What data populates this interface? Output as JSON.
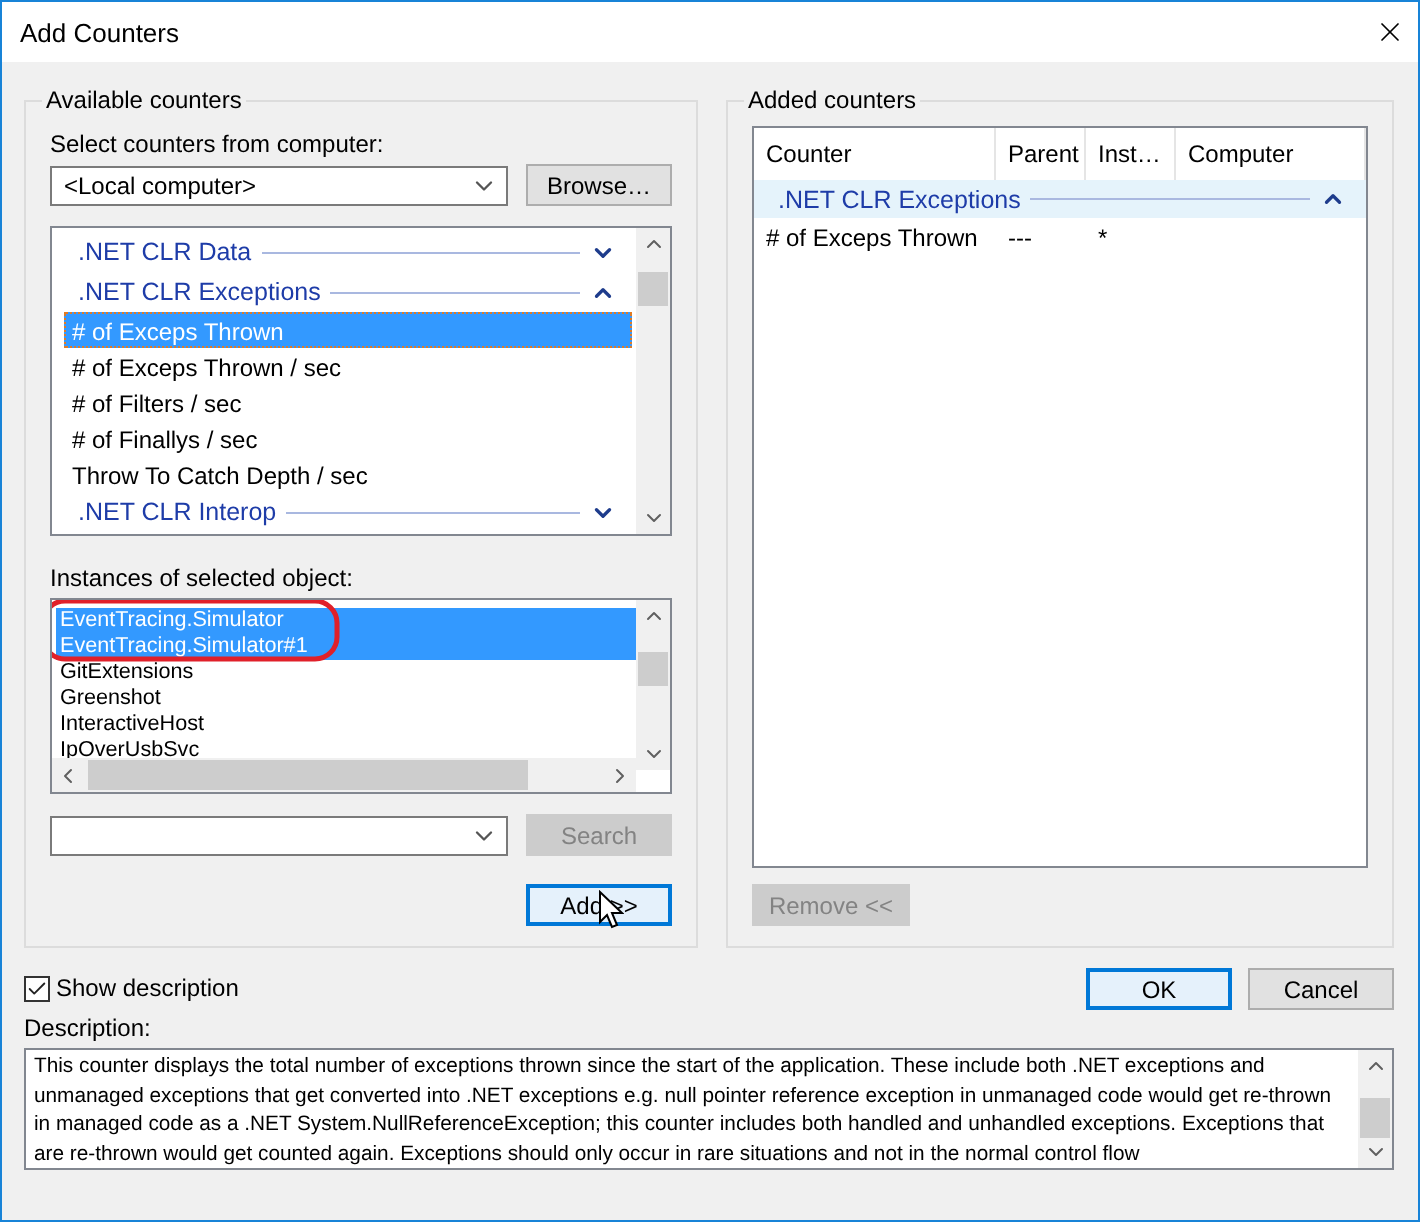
{
  "window": {
    "title": "Add Counters"
  },
  "available": {
    "legend": "Available counters",
    "computer_label": "Select counters from computer:",
    "computer": "<Local computer>",
    "browse_button": "Browse…",
    "counters": [
      {
        "kind": "group",
        "name": ".NET CLR Data",
        "expanded": false
      },
      {
        "kind": "group",
        "name": ".NET CLR Exceptions",
        "expanded": true
      },
      {
        "kind": "counter",
        "name": "# of Exceps Thrown",
        "selected": true
      },
      {
        "kind": "counter",
        "name": "# of Exceps Thrown / sec",
        "selected": false
      },
      {
        "kind": "counter",
        "name": "# of Filters / sec",
        "selected": false
      },
      {
        "kind": "counter",
        "name": "# of Finallys / sec",
        "selected": false
      },
      {
        "kind": "counter",
        "name": "Throw To Catch Depth / sec",
        "selected": false
      },
      {
        "kind": "group",
        "name": ".NET CLR Interop",
        "expanded": false
      }
    ],
    "instances_label": "Instances of selected object:",
    "instances": [
      {
        "name": "EventTracing.Simulator",
        "selected": true
      },
      {
        "name": "EventTracing.Simulator#1",
        "selected": true
      },
      {
        "name": "GitExtensions",
        "selected": false
      },
      {
        "name": "Greenshot",
        "selected": false
      },
      {
        "name": "InteractiveHost",
        "selected": false
      },
      {
        "name": "IpOverUsbSvc",
        "selected": false
      }
    ],
    "search_button": {
      "label": "Search",
      "disabled": true
    },
    "add_button": {
      "label": "Add >>",
      "disabled": false
    }
  },
  "added": {
    "legend": "Added counters",
    "columns": [
      "Counter",
      "Parent",
      "Inst…",
      "Computer"
    ],
    "groups": [
      {
        "name": ".NET CLR Exceptions",
        "expanded": true,
        "rows": [
          {
            "counter": "# of Exceps Thrown",
            "parent": "---",
            "instance": "*"
          }
        ]
      }
    ],
    "remove_button": {
      "label": "Remove <<",
      "disabled": true
    }
  },
  "show_description": {
    "label": "Show description",
    "checked": true
  },
  "ok_button": "OK",
  "cancel_button": "Cancel",
  "description_label": "Description:",
  "description": "This counter displays the total number of exceptions thrown since the start of the application. These include both .NET exceptions and unmanaged exceptions that get converted into .NET exceptions e.g. null pointer reference exception in unmanaged code would get re-thrown in managed code as a .NET System.NullReferenceException; this counter includes both handled and unhandled exceptions. Exceptions that are re-thrown would get counted again. Exceptions should only occur in rare situations and not in the normal control flow"
}
